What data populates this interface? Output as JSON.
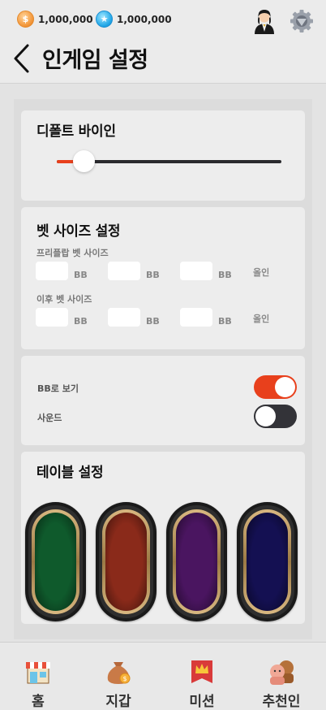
{
  "header": {
    "gold_amount": "1,000,000",
    "gem_amount": "1,000,000",
    "title": "인게임 설정",
    "icons": [
      "gold-coin-icon",
      "gem-coin-icon",
      "dealer-avatar-icon",
      "settings-gear-icon",
      "back-chevron-icon"
    ]
  },
  "default_buyin": {
    "title": "디폴트 바이인",
    "slider_value": 0.12
  },
  "bet_size": {
    "title": "벳 사이즈 설정",
    "preflop_label": "프리플랍 벳 사이즈",
    "after_label": "이후 벳 사이즈",
    "unit": "BB",
    "allin": "올인",
    "preflop_values": [
      "",
      "",
      ""
    ],
    "after_values": [
      "",
      "",
      ""
    ]
  },
  "options": {
    "bb_view_label": "BB로 보기",
    "bb_view_on": true,
    "sound_label": "사운드",
    "sound_on": false
  },
  "table_settings": {
    "title": "테이블 설정",
    "felt_colors": [
      "#0f5a2c",
      "#8a2a1a",
      "#4a1560",
      "#141052"
    ]
  },
  "nav": {
    "items": [
      {
        "label": "홈",
        "icon": "shop-icon"
      },
      {
        "label": "지갑",
        "icon": "money-bag-icon"
      },
      {
        "label": "미션",
        "icon": "crown-banner-icon"
      },
      {
        "label": "추천인",
        "icon": "friends-icon"
      }
    ]
  },
  "colors": {
    "accent": "#e8401c",
    "dark": "#333338"
  }
}
